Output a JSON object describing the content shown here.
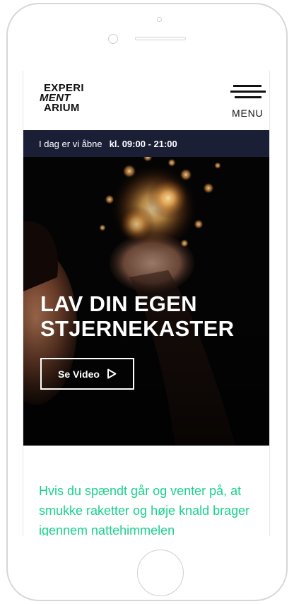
{
  "logo": {
    "line1": "EXPERI",
    "line2": "MENT",
    "line3": "ARIUM"
  },
  "menu": {
    "label": "MENU"
  },
  "hours": {
    "prefix": "I dag er vi åbne",
    "time": "kl. 09:00 - 21:00"
  },
  "hero": {
    "title_line1": "LAV DIN EGEN",
    "title_line2": "STJERNEKASTER",
    "video_button": "Se Video"
  },
  "intro": {
    "text": "Hvis du spændt går og venter på, at smukke raketter og høje knald brager igennem nattehimmelen"
  },
  "colors": {
    "hours_bar": "#1b1f36",
    "accent_green": "#17d38a",
    "hero_bg": "#060505"
  },
  "icons": [
    "hamburger-icon",
    "play-icon"
  ]
}
